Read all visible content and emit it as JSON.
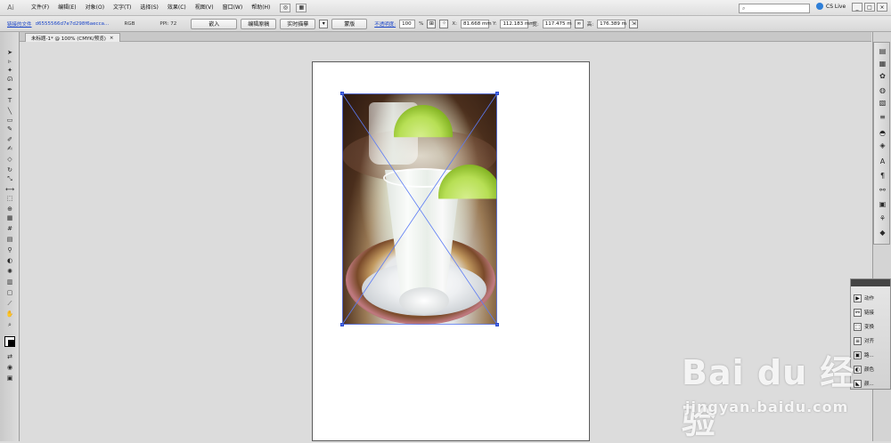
{
  "menubar": {
    "app_logo": "Ai",
    "items": [
      "文件(F)",
      "编辑(E)",
      "对象(O)",
      "文字(T)",
      "选择(S)",
      "效果(C)",
      "视图(V)",
      "窗口(W)",
      "帮助(H)"
    ],
    "extra_icons": [
      "bridge-icon",
      "arrange-documents-icon"
    ],
    "search_placeholder": "",
    "cslive_label": "CS Live",
    "window_buttons": [
      "_",
      "□",
      "×"
    ]
  },
  "controlbar": {
    "linked_file_label": "链接的文件",
    "file_name": "d6555566d7e7d298f6aecca...",
    "color_mode": "RGB",
    "ppi": "PPI: 72",
    "embed_button": "嵌入",
    "edit_original_button": "编辑原稿",
    "live_trace_button": "实时描摹",
    "mask_button": "蒙版",
    "opacity_label": "不透明度:",
    "opacity_value": "100",
    "opacity_unit": "%",
    "x_label": "X:",
    "x_value": "81.668 mm",
    "y_label": "Y:",
    "y_value": "112.183 mm",
    "w_label": "宽:",
    "w_value": "117.475 m",
    "h_label": "高:",
    "h_value": "176.389 m"
  },
  "document_tab": {
    "title": "未标题-1* @ 100% (CMYK/预览)",
    "close": "×"
  },
  "tools": [
    "selection-tool-icon",
    "direct-selection-tool-icon",
    "magic-wand-tool-icon",
    "lasso-tool-icon",
    "pen-tool-icon",
    "type-tool-icon",
    "line-tool-icon",
    "rectangle-tool-icon",
    "paintbrush-tool-icon",
    "pencil-tool-icon",
    "blob-brush-tool-icon",
    "eraser-tool-icon",
    "rotate-tool-icon",
    "scale-tool-icon",
    "width-tool-icon",
    "free-transform-tool-icon",
    "shape-builder-tool-icon",
    "perspective-grid-tool-icon",
    "mesh-tool-icon",
    "gradient-tool-icon",
    "eyedropper-tool-icon",
    "blend-tool-icon",
    "symbol-sprayer-tool-icon",
    "column-graph-tool-icon",
    "artboard-tool-icon",
    "slice-tool-icon",
    "hand-tool-icon",
    "zoom-tool-icon"
  ],
  "right_dock_icons": [
    "color-icon",
    "swatches-icon",
    "brushes-icon",
    "symbols-icon",
    "graphic-styles-icon",
    "stroke-icon",
    "gradient-icon",
    "transparency-icon",
    "appearance-icon",
    "layers-icon",
    "links-icon",
    "pathfinder-icon",
    "align-icon",
    "navigator-icon"
  ],
  "float_panel": {
    "items": [
      {
        "icon": "actions-icon",
        "label": "动作"
      },
      {
        "icon": "links-icon",
        "label": "链接"
      },
      {
        "icon": "transform-icon",
        "label": "变换"
      },
      {
        "icon": "align-icon",
        "label": "对齐"
      },
      {
        "icon": "pathfinder-icon",
        "label": "路..."
      },
      {
        "icon": "color-icon",
        "label": "颜色"
      },
      {
        "icon": "stroke-icon",
        "label": "颜..."
      }
    ]
  },
  "watermark": {
    "main": "Bai du 经验",
    "sub": "jingyan.baidu.com"
  },
  "colors": {
    "accent": "#2d4bcb",
    "link": "#1a45c8"
  }
}
